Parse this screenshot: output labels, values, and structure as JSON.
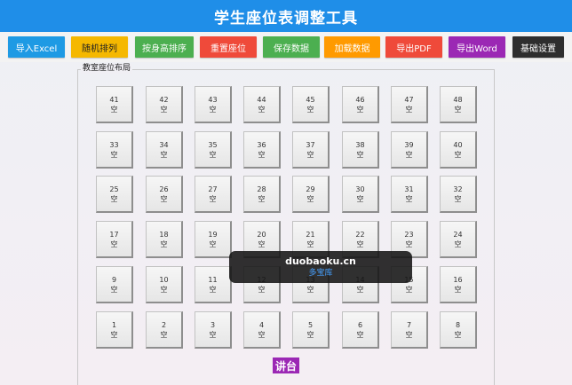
{
  "app": {
    "title": "学生座位表调整工具"
  },
  "toolbar": {
    "buttons": [
      {
        "id": "import-excel",
        "label": "导入Excel",
        "color": "#1e9ae4",
        "text_color": "#ffffff"
      },
      {
        "id": "random",
        "label": "随机排列",
        "color": "#f5b800",
        "text_color": "#222222"
      },
      {
        "id": "height-sort",
        "label": "按身高排序",
        "color": "#4caf50",
        "text_color": "#ffffff"
      },
      {
        "id": "reset",
        "label": "重置座位",
        "color": "#ef4a3a",
        "text_color": "#ffffff"
      },
      {
        "id": "save",
        "label": "保存数据",
        "color": "#4caf50",
        "text_color": "#ffffff"
      },
      {
        "id": "load",
        "label": "加载数据",
        "color": "#ff9a00",
        "text_color": "#ffffff"
      },
      {
        "id": "export-pdf",
        "label": "导出PDF",
        "color": "#ef4a3a",
        "text_color": "#ffffff"
      },
      {
        "id": "export-word",
        "label": "导出Word",
        "color": "#9b28b4",
        "text_color": "#ffffff"
      },
      {
        "id": "settings",
        "label": "基础设置",
        "color": "#2e2e2e",
        "text_color": "#ffffff"
      }
    ]
  },
  "layout": {
    "legend": "教室座位布局",
    "empty_label": "空",
    "rows": [
      [
        41,
        42,
        43,
        44,
        45,
        46,
        47,
        48
      ],
      [
        33,
        34,
        35,
        36,
        37,
        38,
        39,
        40
      ],
      [
        25,
        26,
        27,
        28,
        29,
        30,
        31,
        32
      ],
      [
        17,
        18,
        19,
        20,
        21,
        22,
        23,
        24
      ],
      [
        9,
        10,
        11,
        12,
        13,
        14,
        15,
        16
      ],
      [
        1,
        2,
        3,
        4,
        5,
        6,
        7,
        8
      ]
    ]
  },
  "podium": {
    "label": "讲台"
  },
  "watermark": {
    "line1": "duobaoku.cn",
    "line2": "多宝库"
  }
}
